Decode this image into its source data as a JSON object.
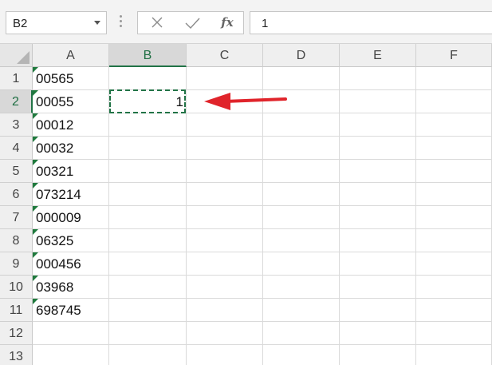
{
  "name_box": {
    "value": "B2"
  },
  "formula_bar": {
    "cancel_icon": "cross-icon",
    "enter_icon": "check-icon",
    "function_label": "fx",
    "value": "1"
  },
  "columns": [
    "A",
    "B",
    "C",
    "D",
    "E",
    "F"
  ],
  "active_column": "B",
  "rows": [
    "1",
    "2",
    "3",
    "4",
    "5",
    "6",
    "7",
    "8",
    "9",
    "10",
    "11",
    "12",
    "13"
  ],
  "active_row": "2",
  "column_a_values": [
    "00565",
    "00055",
    "00012",
    "00032",
    "00321",
    "073214",
    "000009",
    "06325",
    "000456",
    "03968",
    "698745"
  ],
  "cell_b2": "1",
  "colors": {
    "accent_green": "#217346",
    "error_indicator": "#1f7a3d",
    "annotation_arrow": "#e0242b"
  }
}
